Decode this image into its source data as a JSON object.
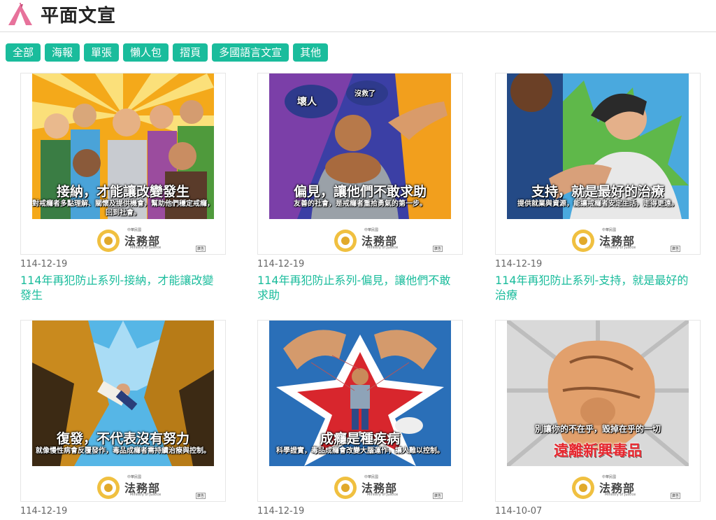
{
  "header": {
    "title": "平面文宣"
  },
  "filters": [
    "全部",
    "海報",
    "單張",
    "懶人包",
    "摺頁",
    "多國語言文宣",
    "其他"
  ],
  "cards": [
    {
      "date": "114-12-19",
      "title": "114年再犯防止系列-接納，才能讓改變發生",
      "poster": {
        "headline": "接納，才能讓改變發生",
        "sub": "對戒癮者多點理解、關懷及提供機會，幫助他們穩定戒癮，回到社會。"
      }
    },
    {
      "date": "114-12-19",
      "title": "114年再犯防止系列-偏見，讓他們不敢求助",
      "poster": {
        "headline": "偏見，讓他們不敢求助",
        "sub": "友善的社會，是戒癮者重拾勇氣的第一步。",
        "bubble1": "壞人",
        "bubble2": "沒救了"
      }
    },
    {
      "date": "114-12-19",
      "title": "114年再犯防止系列-支持，就是最好的治療",
      "poster": {
        "headline": "支持，就是最好的治療",
        "sub": "提供就業與資源，能讓戒癮者安定生活，走得更遠。"
      }
    },
    {
      "date": "114-12-19",
      "title": "",
      "poster": {
        "headline": "復發，不代表沒有努力",
        "sub": "就像慢性病會反覆發作，毒品成癮者需持續治療與控制。"
      }
    },
    {
      "date": "114-12-19",
      "title": "",
      "poster": {
        "headline": "成癮是種疾病",
        "sub": "科學證實，毒品成癮會改變大腦運作，讓人難以控制。"
      }
    },
    {
      "date": "114-10-07",
      "title": "",
      "poster": {
        "headline": "遠離新興毒品",
        "sub": "別讓你的不在乎，毀掉在乎的一切"
      }
    }
  ],
  "brand": {
    "org_small": "中華民國",
    "org": "法務部",
    "org_en": "Ministry of Justice",
    "tag": "廣告"
  },
  "colors": {
    "accent": "#1abc9c",
    "logo": "#e7729b"
  }
}
